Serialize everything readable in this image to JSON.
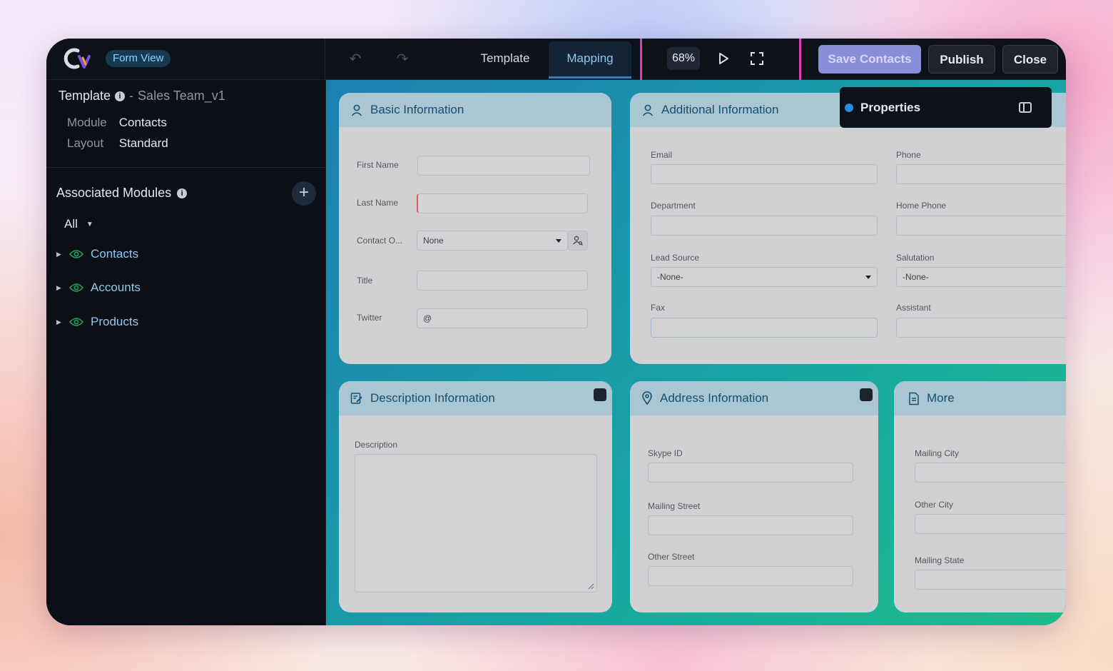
{
  "header": {
    "view_label": "Form View",
    "undo_glyph": "↶",
    "redo_glyph": "↷",
    "tabs": [
      {
        "label": "Template",
        "active": false
      },
      {
        "label": "Mapping",
        "active": true
      }
    ],
    "zoom": "68%",
    "save_label": "Save Contacts",
    "publish_label": "Publish",
    "close_label": "Close"
  },
  "sidebar": {
    "template_label": "Template",
    "separator": "-",
    "template_name": "Sales Team_v1",
    "info_glyph": "i",
    "module_key": "Module",
    "module_value": "Contacts",
    "layout_key": "Layout",
    "layout_value": "Standard",
    "associated_title": "Associated Modules",
    "add_glyph": "+",
    "filter_value": "All",
    "filter_caret": "▼",
    "expand_glyph": "▶",
    "modules": [
      {
        "label": "Contacts",
        "icon": "eye-icon"
      },
      {
        "label": "Accounts",
        "icon": "eye-icon"
      },
      {
        "label": "Products",
        "icon": "eye-icon"
      }
    ]
  },
  "properties": {
    "title": "Properties"
  },
  "sections": {
    "basic": {
      "title": "Basic Information",
      "first_name_label": "First Name",
      "last_name_label": "Last Name",
      "contact_owner_label": "Contact O...",
      "contact_owner_value": "None",
      "title_label": "Title",
      "twitter_label": "Twitter",
      "twitter_prefix": "@"
    },
    "additional": {
      "title": "Additional Information",
      "email_label": "Email",
      "phone_label": "Phone",
      "department_label": "Department",
      "home_phone_label": "Home Phone",
      "lead_source_label": "Lead Source",
      "lead_source_value": "-None-",
      "salutation_label": "Salutation",
      "salutation_value": "-None-",
      "fax_label": "Fax",
      "assistant_label": "Assistant"
    },
    "description": {
      "title": "Description Information",
      "description_label": "Description"
    },
    "address": {
      "title": "Address Information",
      "skype_label": "Skype ID",
      "mailing_street_label": "Mailing Street",
      "other_street_label": "Other Street"
    },
    "more": {
      "title": "More",
      "mailing_city_label": "Mailing City",
      "other_city_label": "Other City",
      "mailing_state_label": "Mailing State"
    }
  },
  "colors": {
    "accent": "#8ec9f2",
    "highlight": "#e13bb7",
    "save_button": "#8a8ed8",
    "card_header": "#a9c6d2",
    "module_icon": "#1fa35f"
  }
}
